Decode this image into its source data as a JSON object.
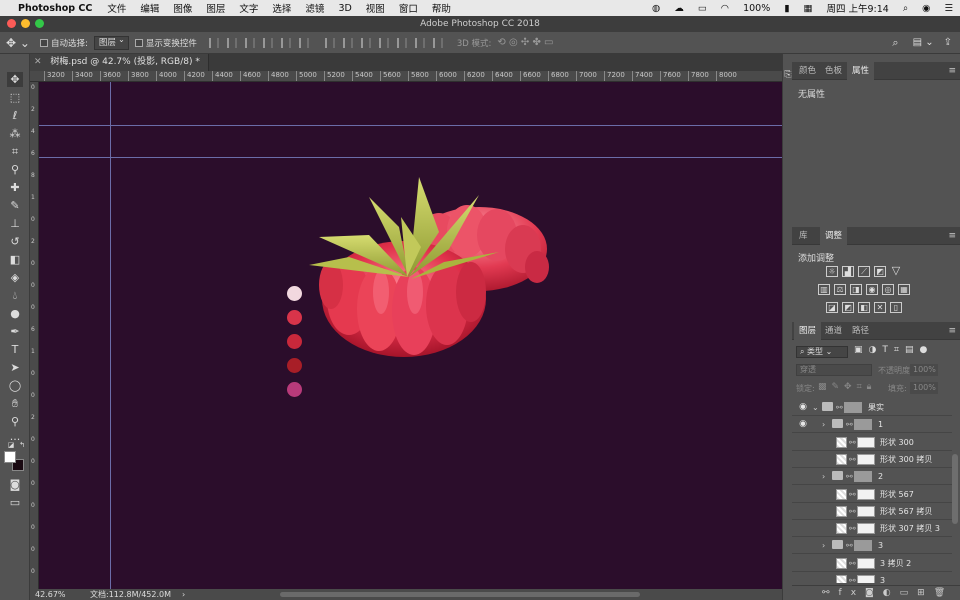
{
  "menubar": {
    "apple": "",
    "app_name": "Photoshop CC",
    "items": [
      "文件",
      "编辑",
      "图像",
      "图层",
      "文字",
      "选择",
      "滤镜",
      "3D",
      "视图",
      "窗口",
      "帮助"
    ],
    "battery": "100%",
    "clock": "周四 上午9:14"
  },
  "window": {
    "title": "Adobe Photoshop CC 2018"
  },
  "options_bar": {
    "auto_select_label": "自动选择:",
    "auto_select_value": "图层",
    "show_transform_label": "显示变换控件",
    "mode_3d_label": "3D 模式:"
  },
  "document": {
    "tab_label": "树梅.psd @ 42.7% (投影, RGB/8) *",
    "ruler_ticks": [
      "3200",
      "3400",
      "3600",
      "3800",
      "4000",
      "4200",
      "4400",
      "4600",
      "4800",
      "5000",
      "5200",
      "5400",
      "5600",
      "5800",
      "6000",
      "6200",
      "6400",
      "6600",
      "6800",
      "7000",
      "7200",
      "7400",
      "7600",
      "7800",
      "8000"
    ],
    "ruler_v_ticks": [
      "0",
      "2",
      "4",
      "6",
      "8",
      "1",
      "0",
      "2",
      "0",
      "0",
      "0",
      "6",
      "1",
      "0",
      "0",
      "2",
      "0",
      "0",
      "0",
      "0",
      "0",
      "0",
      "0"
    ],
    "swatch_colors": [
      "#f2d8df",
      "#d8344a",
      "#c8283b",
      "#a81e27",
      "#b83a7a"
    ],
    "bg_color": "#2b0d2b"
  },
  "status": {
    "zoom": "42.67%",
    "doc_size": "文档:112.8M/452.0M"
  },
  "panels": {
    "top_tabs": [
      "颜色",
      "色板",
      "属性"
    ],
    "properties_text": "无属性",
    "mid_tabs": [
      "库",
      "调整"
    ],
    "adjust_title": "添加调整",
    "layer_tabs": [
      "图层",
      "通道",
      "路径"
    ],
    "filter_kind": "类型",
    "blend_mode": "穿透",
    "opacity_label": "不透明度:",
    "opacity_value": "100%",
    "lock_label": "锁定:",
    "fill_label": "填充:",
    "fill_value": "100%"
  },
  "layers": [
    {
      "name": "果实",
      "type": "group",
      "visible": true,
      "indent": 0,
      "open": true
    },
    {
      "name": "1",
      "type": "group",
      "visible": true,
      "indent": 1,
      "open": false
    },
    {
      "name": "形状 300",
      "type": "shape",
      "visible": false,
      "indent": 2
    },
    {
      "name": "形状 300 拷贝",
      "type": "shape",
      "visible": false,
      "indent": 2
    },
    {
      "name": "2",
      "type": "group",
      "visible": false,
      "indent": 1,
      "open": false
    },
    {
      "name": "形状 567",
      "type": "shape",
      "visible": false,
      "indent": 2
    },
    {
      "name": "形状 567 拷贝",
      "type": "shape",
      "visible": false,
      "indent": 2
    },
    {
      "name": "形状 307 拷贝 3",
      "type": "shape",
      "visible": false,
      "indent": 2
    },
    {
      "name": "3",
      "type": "group",
      "visible": false,
      "indent": 1,
      "open": false
    },
    {
      "name": "3 拷贝 2",
      "type": "shape",
      "visible": false,
      "indent": 2
    },
    {
      "name": "3",
      "type": "shape",
      "visible": false,
      "indent": 2
    }
  ],
  "colors": {
    "accent_fruit": "#e0304a",
    "leaf": "#b8c050"
  }
}
